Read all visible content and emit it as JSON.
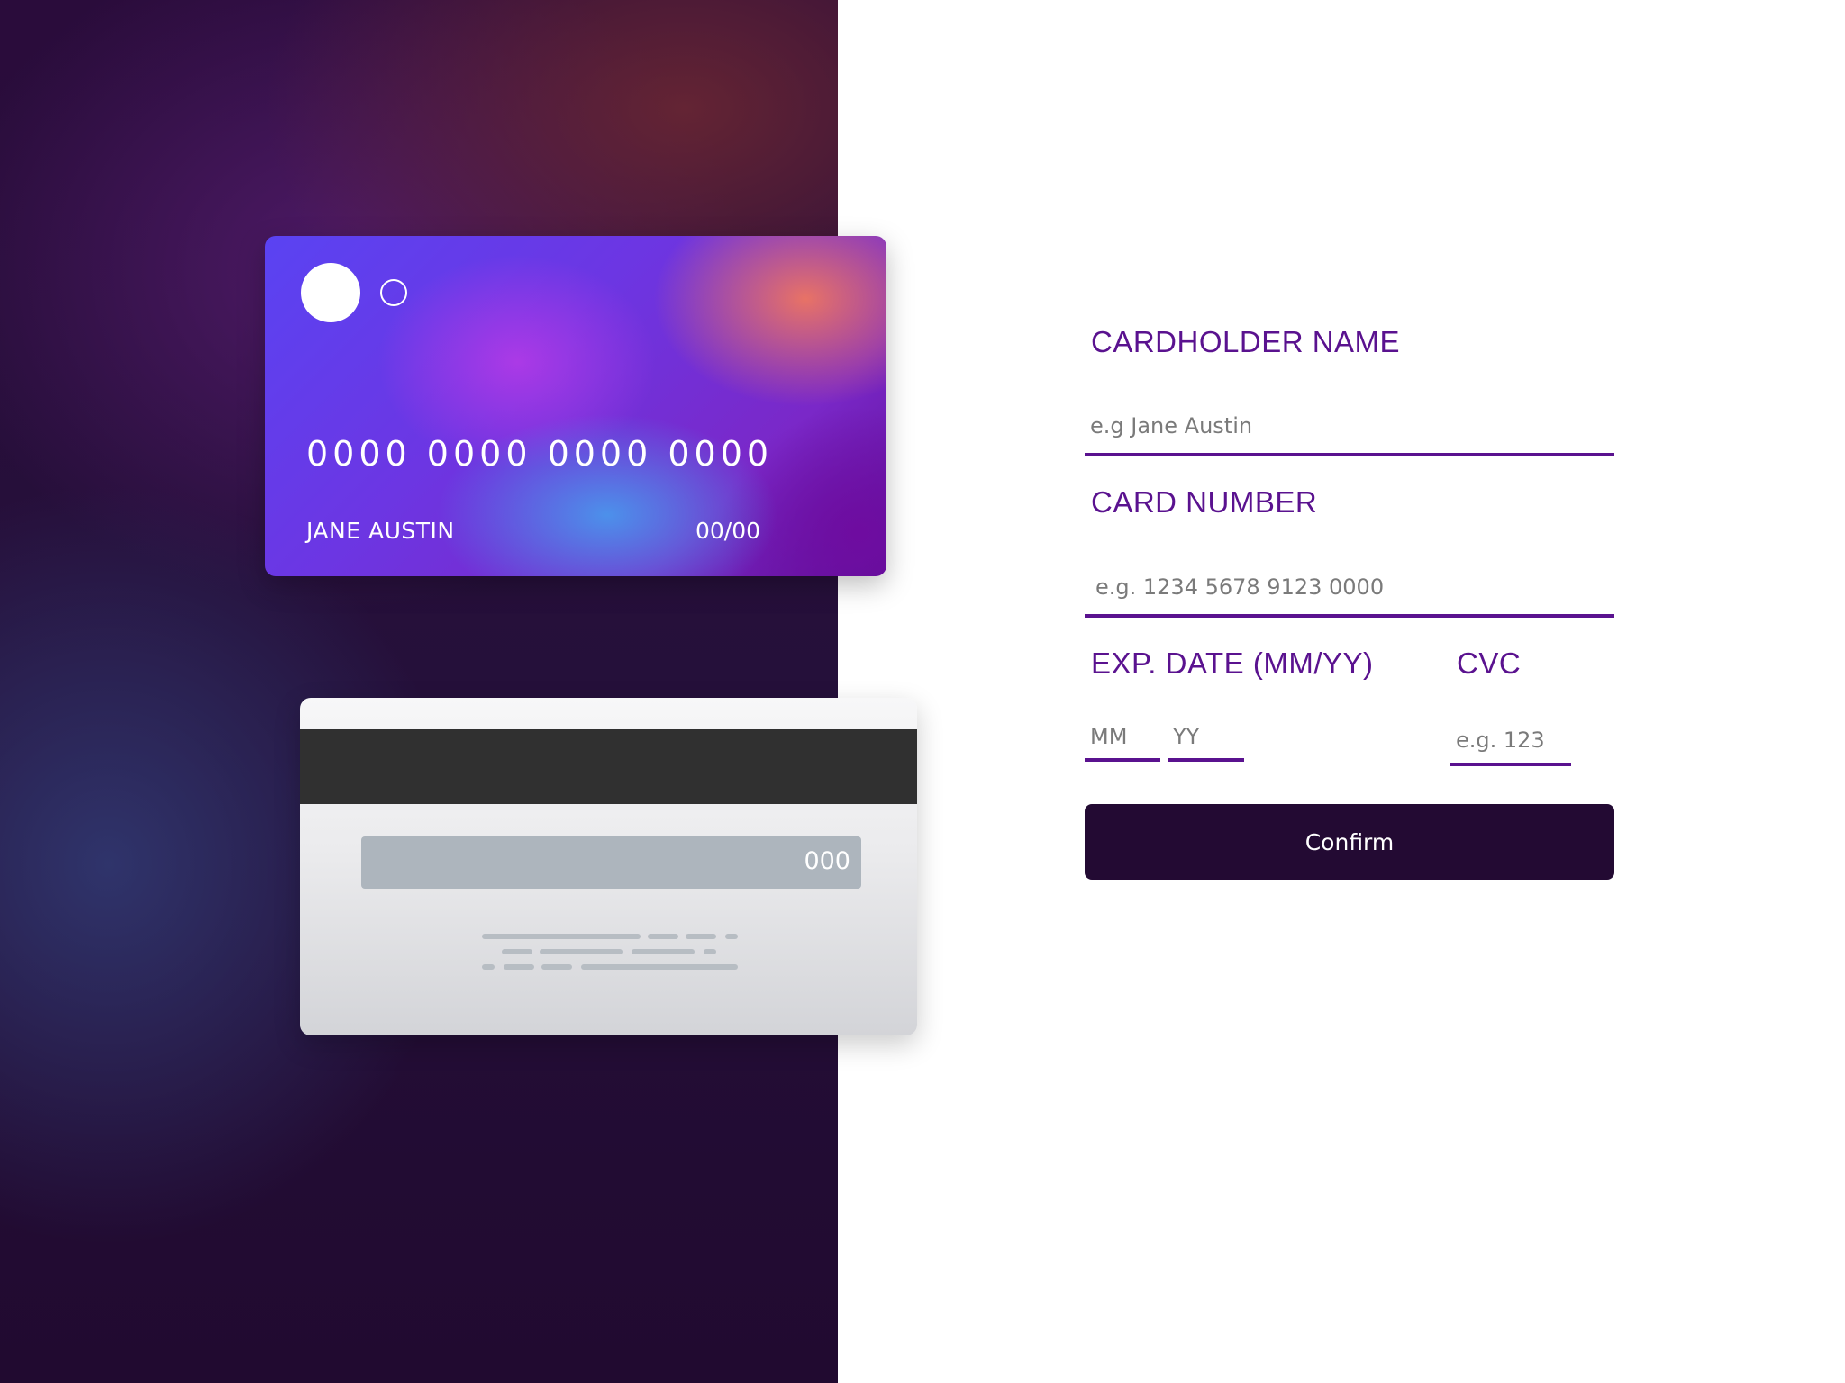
{
  "card_front": {
    "number": "0000 0000 0000 0000",
    "name": "JANE AUSTIN",
    "expiry": "00/00"
  },
  "card_back": {
    "cvc": "000"
  },
  "form": {
    "cardholder_name": {
      "label": "CARDHOLDER NAME",
      "placeholder": "e.g Jane Austin",
      "value": ""
    },
    "card_number": {
      "label": "CARD NUMBER",
      "placeholder": "e.g. 1234 5678 9123 0000",
      "value": ""
    },
    "exp_date": {
      "label": "EXP. DATE (MM/YY)",
      "month_placeholder": "MM",
      "year_placeholder": "YY"
    },
    "cvc": {
      "label": "CVC",
      "placeholder": "e.g. 123",
      "value": ""
    },
    "confirm_label": "Confirm"
  },
  "colors": {
    "accent": "#5a128f",
    "button_bg": "#230a33",
    "left_panel_bg": "#210a30"
  }
}
